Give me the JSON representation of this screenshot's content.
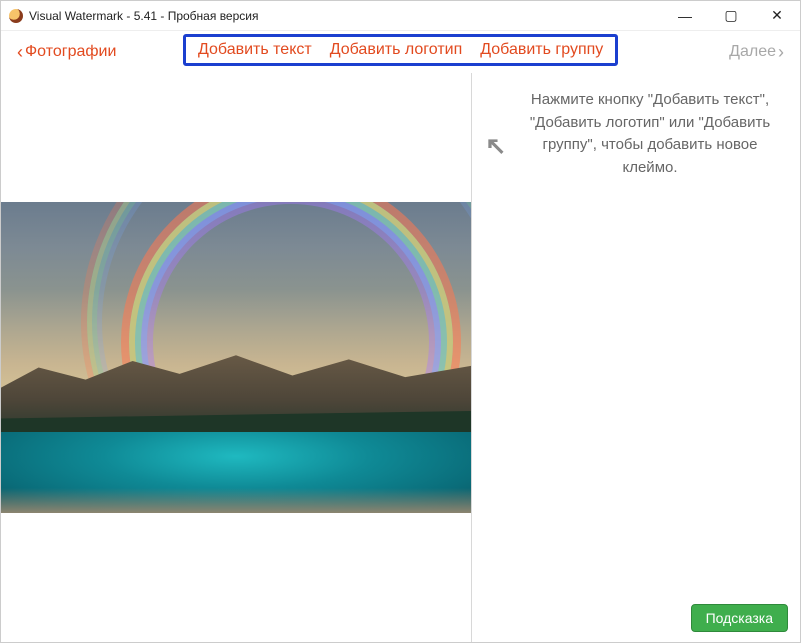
{
  "window": {
    "title": "Visual Watermark - 5.41 - Пробная версия"
  },
  "toolbar": {
    "back_label": "Фотографии",
    "add_text_label": "Добавить текст",
    "add_logo_label": "Добавить логотип",
    "add_group_label": "Добавить группу",
    "next_label": "Далее"
  },
  "sidepanel": {
    "hint_text": "Нажмите кнопку \"Добавить текст\", \"Добавить логотип\" или \"Добавить группу\", чтобы добавить новое клеймо.",
    "tip_button_label": "Подсказка"
  },
  "icons": {
    "back_chevron": "‹",
    "next_chevron": "›",
    "minimize": "—",
    "maximize": "▢",
    "close": "✕"
  }
}
